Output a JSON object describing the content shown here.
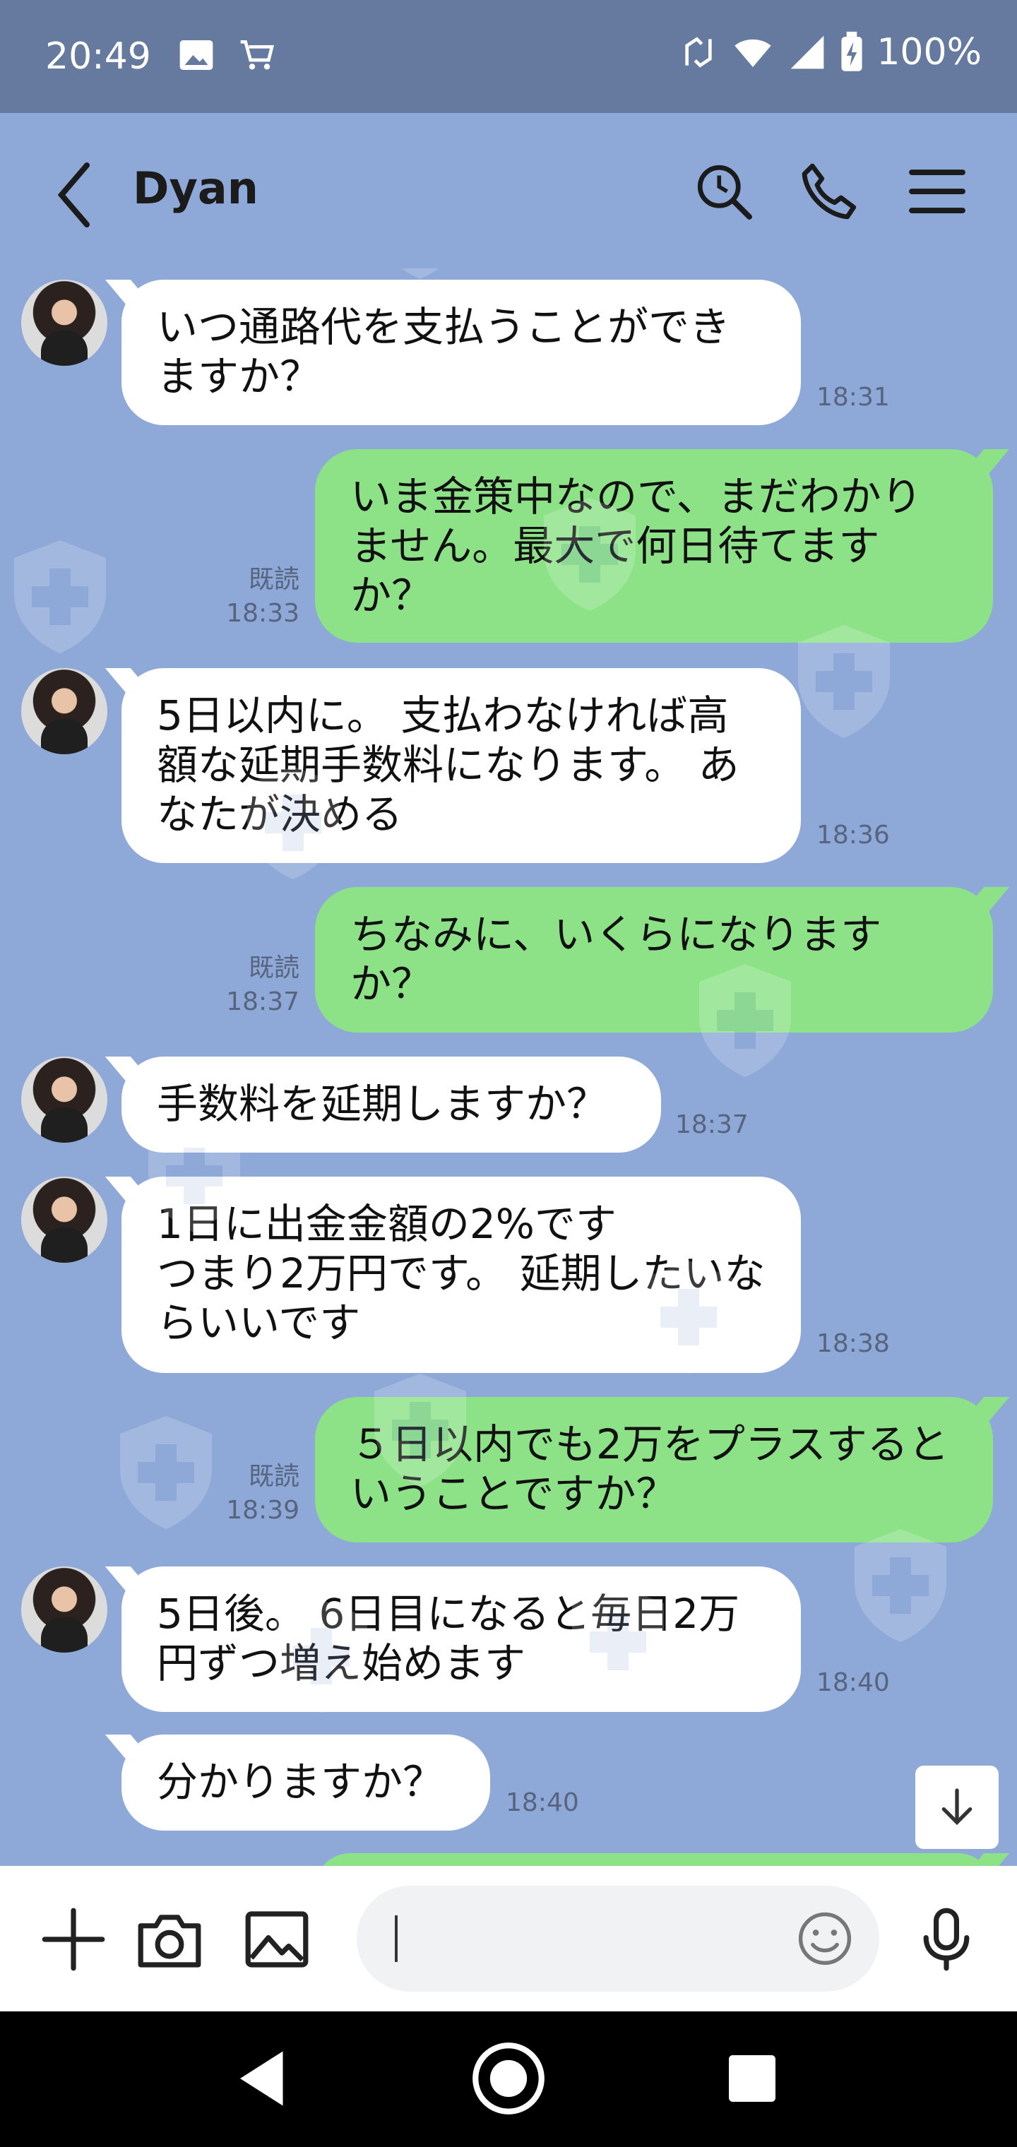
{
  "status_bar": {
    "time": "20:49",
    "battery": "100%"
  },
  "header": {
    "contact_name": "Dyan"
  },
  "messages": [
    {
      "direction": "in",
      "text": "いつ通路代を支払うことができますか？",
      "time": "18:31"
    },
    {
      "direction": "out",
      "text": "いま金策中なので、まだわかりません。最大で何日待てますか？",
      "read": "既読",
      "time": "18:33"
    },
    {
      "direction": "in",
      "text": "5日以内に。 支払わなければ高額な延期手数料になります。 あなたが決める",
      "time": "18:36"
    },
    {
      "direction": "out",
      "text": "ちなみに、いくらになりますか？",
      "read": "既読",
      "time": "18:37"
    },
    {
      "direction": "in",
      "text": "手数料を延期しますか？",
      "time": "18:37"
    },
    {
      "direction": "in",
      "text": "1日に出金金額の2%です\nつまり2万円です。 延期したいならいいです",
      "time": "18:38"
    },
    {
      "direction": "out",
      "text": "５日以内でも2万をプラスするということですか？",
      "read": "既読",
      "time": "18:39"
    },
    {
      "direction": "in",
      "text": "5日後。 6日目になると毎日2万円ずつ増え始めます",
      "time": "18:40"
    },
    {
      "direction": "in",
      "text": "分かりますか？",
      "time": "18:40"
    }
  ],
  "icons": {
    "status": [
      "gallery-icon",
      "cart-icon",
      "nfc-icon",
      "wifi-icon",
      "signal-icon",
      "battery-icon"
    ],
    "header": [
      "back-icon",
      "search-icon",
      "phone-icon",
      "menu-icon"
    ],
    "input": [
      "plus-icon",
      "camera-icon",
      "image-icon",
      "emoji-icon",
      "mic-icon"
    ],
    "nav": [
      "nav-back-icon",
      "nav-home-icon",
      "nav-recents-icon"
    ]
  },
  "colors": {
    "chat_bg": "#8ea9d8",
    "outgoing": "#8de287",
    "incoming": "#ffffff",
    "status_bar": "#657a9e"
  }
}
